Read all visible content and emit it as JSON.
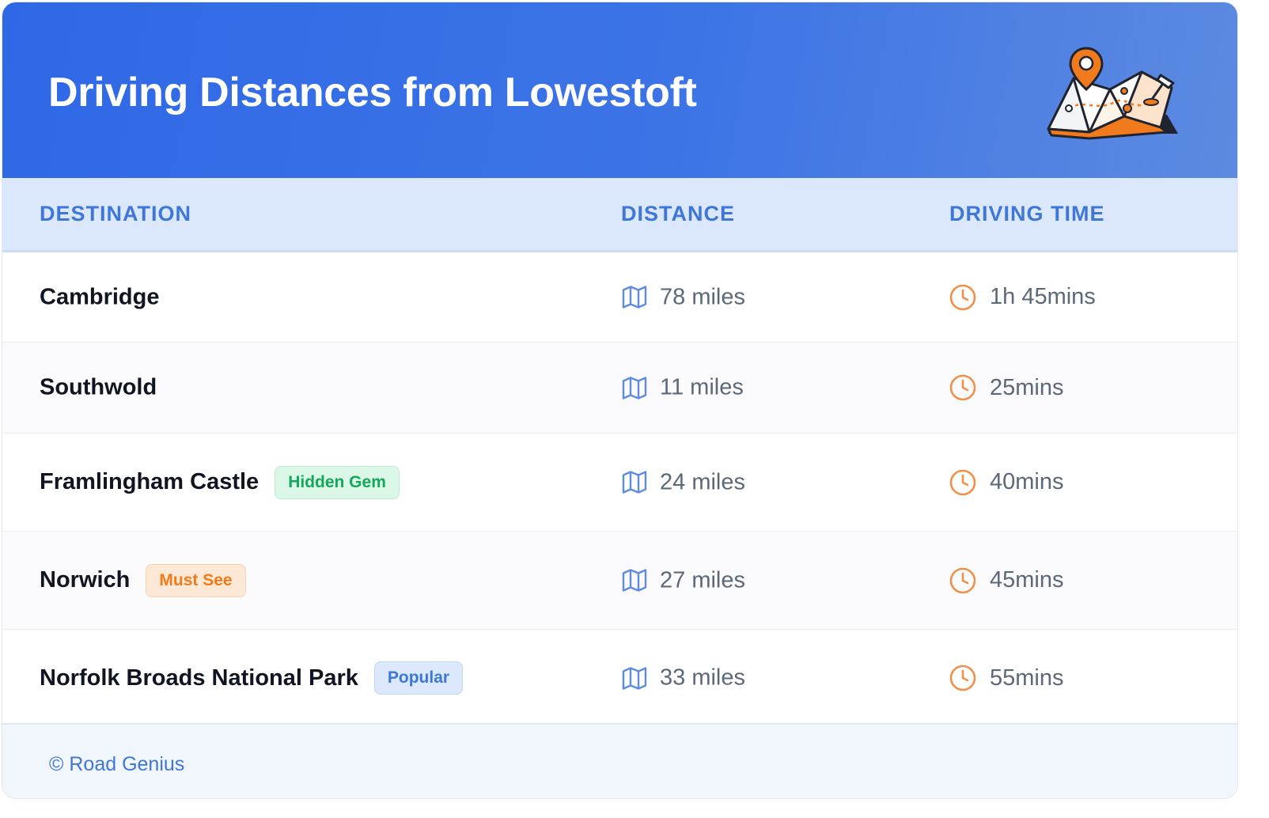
{
  "header": {
    "title": "Driving Distances from Lowestoft"
  },
  "illustration": "map-with-location-pin-icon",
  "table": {
    "columns": [
      "DESTINATION",
      "DISTANCE",
      "DRIVING TIME"
    ],
    "rows": [
      {
        "destination": "Cambridge",
        "badge": null,
        "distance": "78 miles",
        "time": "1h 45mins"
      },
      {
        "destination": "Southwold",
        "badge": null,
        "distance": "11 miles",
        "time": "25mins"
      },
      {
        "destination": "Framlingham Castle",
        "badge": "Hidden Gem",
        "badge_color": "#15a85a",
        "distance": "24 miles",
        "time": "40mins"
      },
      {
        "destination": "Norwich",
        "badge": "Must See",
        "badge_color": "#f07a1c",
        "distance": "27 miles",
        "time": "45mins"
      },
      {
        "destination": "Norfolk Broads National Park",
        "badge": "Popular",
        "badge_color": "#3f77d8",
        "distance": "33 miles",
        "time": "55mins"
      }
    ],
    "distance_icon": "map-icon",
    "time_icon": "clock-icon"
  },
  "footer": {
    "credit": "© Road Genius"
  },
  "colors": {
    "header_start": "#2f68e6",
    "header_end": "#5d8ae0",
    "accent_blue": "#3f77d8",
    "clock_orange": "#f0904a"
  }
}
